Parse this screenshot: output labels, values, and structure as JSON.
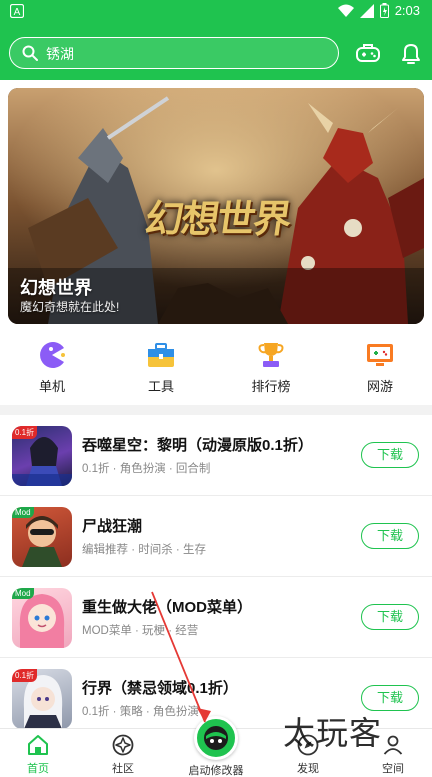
{
  "status_bar": {
    "time": "2:03"
  },
  "search": {
    "placeholder": "锈湖"
  },
  "banner": {
    "title": "幻想世界",
    "subtitle": "魔幻奇想就在此处!",
    "logo_text": "幻想世界"
  },
  "categories": [
    {
      "label": "单机",
      "icon": "pacman-icon"
    },
    {
      "label": "工具",
      "icon": "toolbox-icon"
    },
    {
      "label": "排行榜",
      "icon": "trophy-icon"
    },
    {
      "label": "网游",
      "icon": "gamepad-screen-icon"
    }
  ],
  "games": [
    {
      "name": "吞噬星空：黎明（动漫原版0.1折）",
      "tags": "0.1折 · 角色扮演 · 回合制",
      "badge": "0.1折",
      "button": "下载"
    },
    {
      "name": "尸战狂潮",
      "tags": "编辑推荐 · 时间杀 · 生存",
      "badge": "Mod",
      "button": "下载"
    },
    {
      "name": "重生做大佬（MOD菜单）",
      "tags": "MOD菜单 · 玩梗 · 经营",
      "badge": "Mod",
      "button": "下载"
    },
    {
      "name": "行界（禁忌领域0.1折）",
      "tags": "0.1折 · 策略 · 角色扮演",
      "badge": "0.1折",
      "button": "下载"
    }
  ],
  "tabs": [
    {
      "label": "首页",
      "icon": "home-icon",
      "active": true
    },
    {
      "label": "社区",
      "icon": "community-icon",
      "active": false
    },
    {
      "label": "启动修改器",
      "icon": "launcher-icon",
      "active": false
    },
    {
      "label": "发现",
      "icon": "discover-icon",
      "active": false
    },
    {
      "label": "空间",
      "icon": "space-icon",
      "active": false
    }
  ],
  "watermark": {
    "text": "太玩客"
  },
  "colors": {
    "brand": "#1fc34f",
    "text": "#111111",
    "muted": "#888888"
  }
}
